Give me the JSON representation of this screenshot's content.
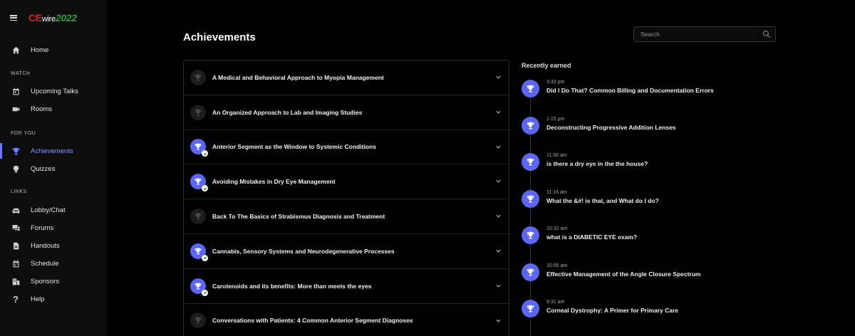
{
  "brand": {
    "ce": "CE",
    "wire": "wire",
    "year": "2022"
  },
  "sidebar": {
    "home": "Home",
    "watch_label": "WATCH",
    "upcoming": "Upcoming Talks",
    "rooms": "Rooms",
    "foryou_label": "FOR YOU",
    "achievements": "Achievements",
    "quizzes": "Quizzes",
    "links_label": "LINKS",
    "lobby": "Lobby/Chat",
    "forums": "Forums",
    "handouts": "Handouts",
    "schedule": "Schedule",
    "sponsors": "Sponsors",
    "help": "Help"
  },
  "page": {
    "title": "Achievements"
  },
  "search": {
    "placeholder": "Search"
  },
  "achievements": [
    {
      "title": "A Medical and Behavioral Approach to Myopia Management",
      "earned": false
    },
    {
      "title": "An Organized Approach to Lab and Imaging Studies",
      "earned": false
    },
    {
      "title": "Anterior Segment as the Window to Systemic Conditions",
      "earned": true
    },
    {
      "title": "Avoiding Mistakes in Dry Eye Management",
      "earned": true
    },
    {
      "title": "Back To The Basics of Strabismus Diagnosis and Treatment",
      "earned": false
    },
    {
      "title": "Cannabis, Sensory Systems and Neurodegenerative Processes",
      "earned": true
    },
    {
      "title": "Carotenoids and its benefits: More than meets the eyes",
      "earned": true
    },
    {
      "title": "Conversations with Patients: 4 Common Anterior Segment Diagnoses",
      "earned": false
    }
  ],
  "recent": {
    "title": "Recently earned",
    "items": [
      {
        "time": "3:33 pm",
        "title": "Did I Do That? Common Billing and Documentation Errors"
      },
      {
        "time": "1:15 pm",
        "title": "Deconstructing Progressive Addition Lenses"
      },
      {
        "time": "11:30 am",
        "title": "is there a dry eye in the the house?"
      },
      {
        "time": "11:16 am",
        "title": "What the &#! is that, and What do I do?"
      },
      {
        "time": "10:32 am",
        "title": "what is a DIABETIC EYE exam?"
      },
      {
        "time": "10:00 am",
        "title": "Effective Management of the Angle Closure Spectrum"
      },
      {
        "time": "9:31 am",
        "title": "Corneal Dystrophy: A Primer for Primary Care"
      }
    ]
  },
  "colors": {
    "accent": "#5b67f0",
    "active_nav": "#8f99ff",
    "brand_red": "#e02020",
    "brand_green": "#2f9e3a"
  }
}
